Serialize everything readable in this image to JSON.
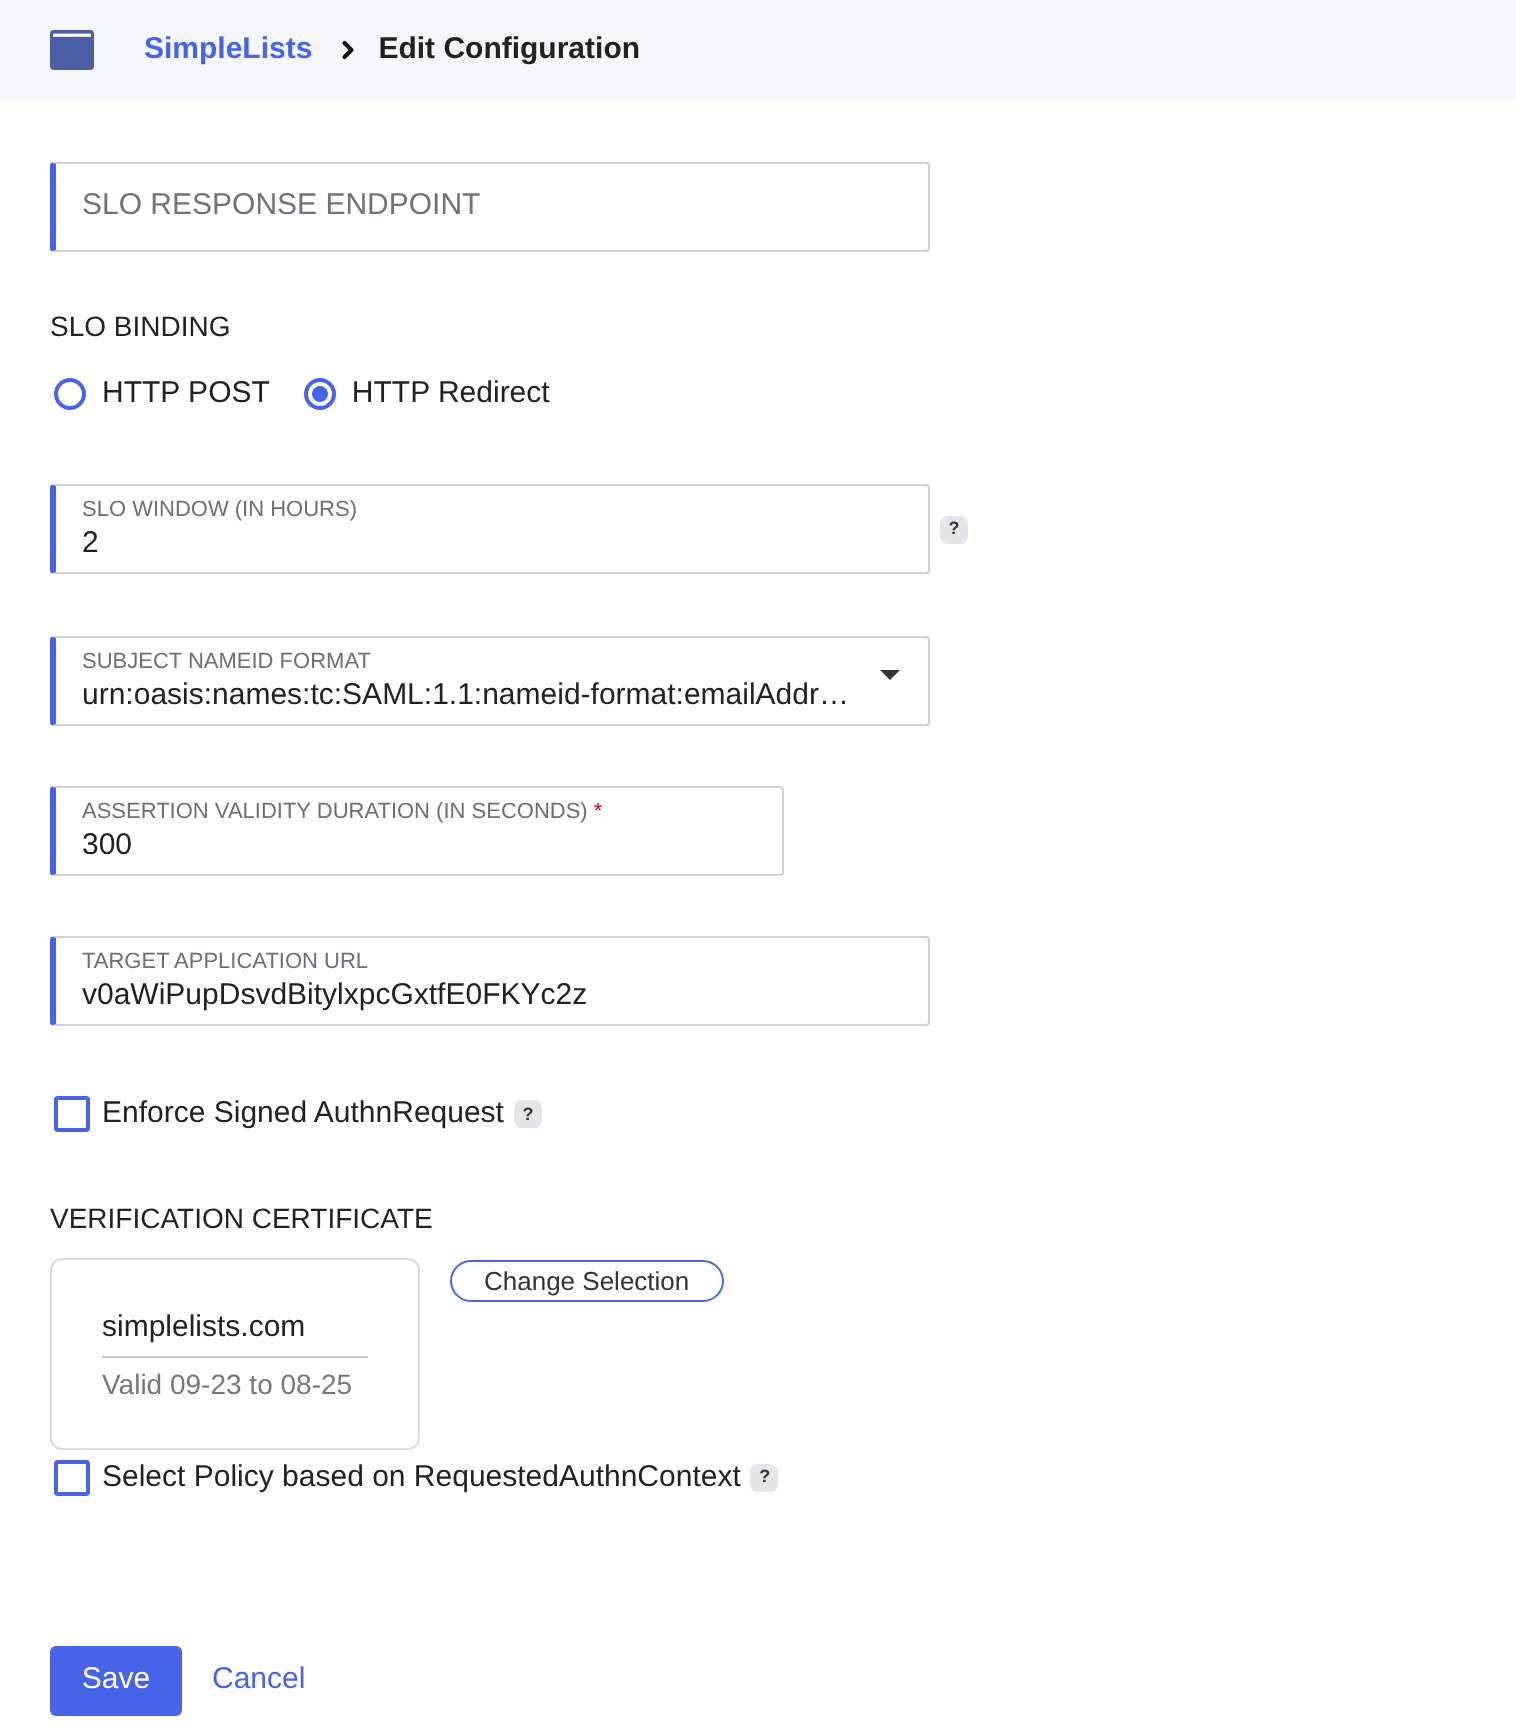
{
  "breadcrumb": {
    "parent": "SimpleLists",
    "current": "Edit Configuration"
  },
  "slo_response_endpoint": {
    "placeholder": "SLO RESPONSE ENDPOINT"
  },
  "slo_binding": {
    "label": "SLO BINDING",
    "options": [
      {
        "label": "HTTP POST",
        "selected": false
      },
      {
        "label": "HTTP Redirect",
        "selected": true
      }
    ]
  },
  "slo_window": {
    "label": "SLO WINDOW (IN HOURS)",
    "value": "2",
    "help": "?"
  },
  "subject_nameid_format": {
    "label": "SUBJECT NAMEID FORMAT",
    "value": "urn:oasis:names:tc:SAML:1.1:nameid-format:emailAddr…"
  },
  "assertion_validity_duration": {
    "label": "ASSERTION VALIDITY DURATION (IN SECONDS)",
    "required_mark": "*",
    "value": "300"
  },
  "target_application_url": {
    "label": "TARGET APPLICATION URL",
    "value": "v0aWiPupDsvdBitylxpcGxtfE0FKYc2z"
  },
  "enforce_signed_authn_request": {
    "label": "Enforce Signed AuthnRequest",
    "checked": false,
    "help": "?"
  },
  "verification_certificate": {
    "label": "VERIFICATION CERTIFICATE",
    "name": "simplelists.com",
    "validity": "Valid 09-23 to 08-25",
    "change_button": "Change Selection"
  },
  "select_policy": {
    "label": "Select Policy based on RequestedAuthnContext",
    "checked": false,
    "help": "?"
  },
  "actions": {
    "save": "Save",
    "cancel": "Cancel"
  }
}
